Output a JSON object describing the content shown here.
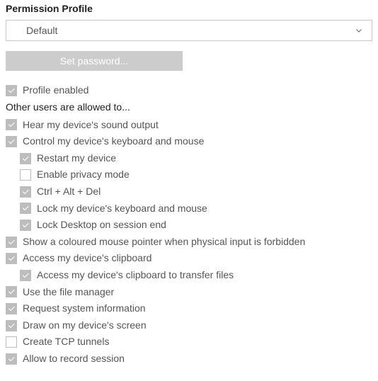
{
  "heading": "Permission Profile",
  "profile_selected": "Default",
  "set_password_label": "Set password...",
  "subheading": "Other users are allowed to...",
  "items": {
    "profile_enabled": {
      "label": "Profile enabled",
      "checked": true
    },
    "hear_sound": {
      "label": "Hear my device's sound output",
      "checked": true
    },
    "control_kbm": {
      "label": "Control my device's keyboard and mouse",
      "checked": true
    },
    "restart": {
      "label": "Restart my device",
      "checked": true
    },
    "privacy": {
      "label": "Enable privacy mode",
      "checked": false
    },
    "ctrl_alt_del": {
      "label": "Ctrl + Alt + Del",
      "checked": true
    },
    "lock_kbm": {
      "label": "Lock my device's keyboard and mouse",
      "checked": true
    },
    "lock_desktop": {
      "label": "Lock Desktop on session end",
      "checked": true
    },
    "coloured_pointer": {
      "label": "Show a coloured mouse pointer when physical input is forbidden",
      "checked": true
    },
    "clipboard": {
      "label": "Access my device's clipboard",
      "checked": true
    },
    "clipboard_files": {
      "label": "Access my device's clipboard to transfer files",
      "checked": true
    },
    "file_manager": {
      "label": "Use the file manager",
      "checked": true
    },
    "system_info": {
      "label": "Request system information",
      "checked": true
    },
    "draw_screen": {
      "label": "Draw on my device's screen",
      "checked": true
    },
    "tcp_tunnels": {
      "label": "Create TCP tunnels",
      "checked": false
    },
    "record_session": {
      "label": "Allow to record session",
      "checked": true
    }
  }
}
